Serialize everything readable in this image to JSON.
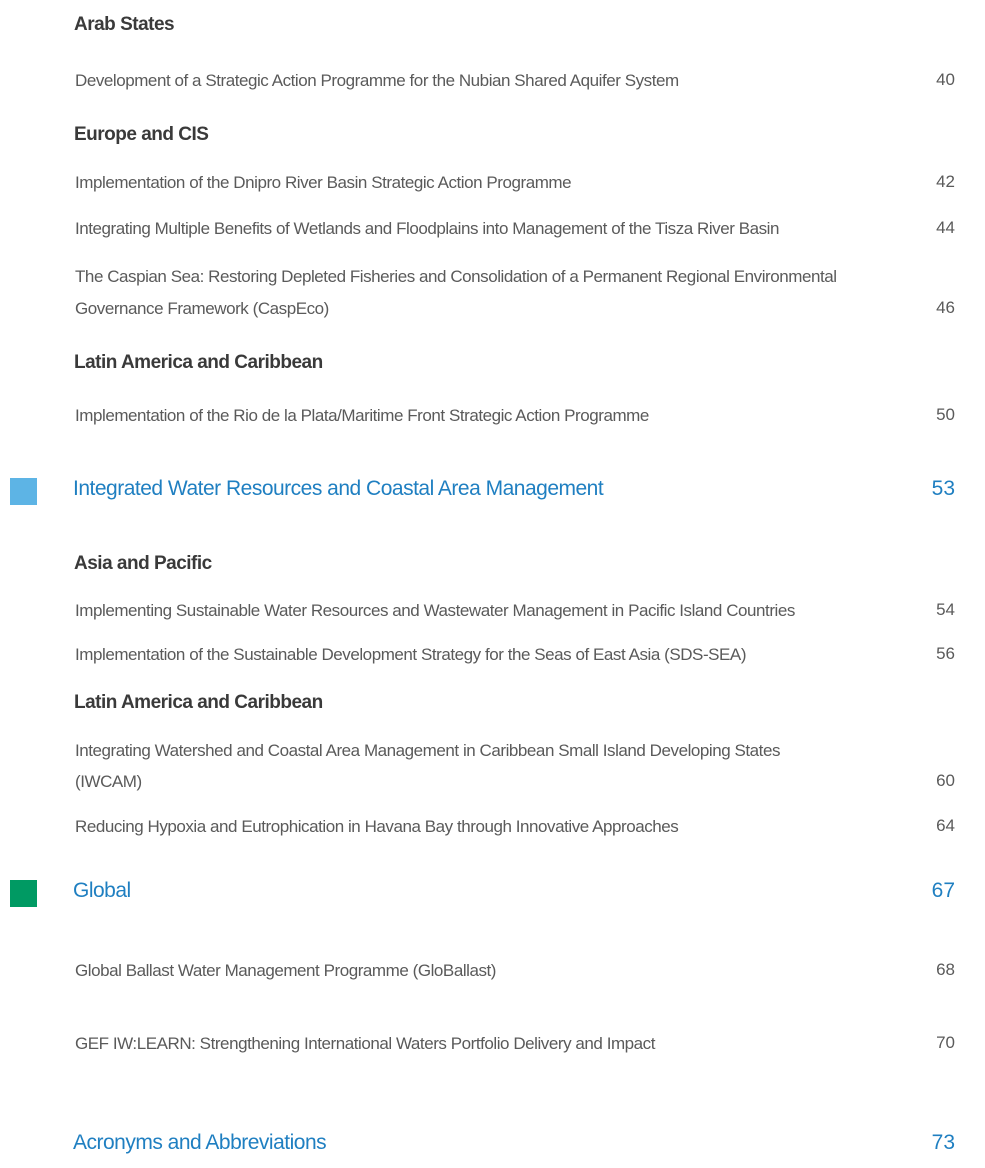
{
  "toc": {
    "arab_states": {
      "heading": "Arab States",
      "entries": [
        {
          "title": "Development of a Strategic Action Programme for the Nubian Shared Aquifer System",
          "page": "40"
        }
      ]
    },
    "europe_cis": {
      "heading": "Europe and CIS",
      "entries": [
        {
          "title": "Implementation of the Dnipro River Basin Strategic Action Programme",
          "page": "42"
        },
        {
          "title": "Integrating Multiple Benefits of Wetlands and Floodplains into Management of the Tisza River Basin",
          "page": "44"
        },
        {
          "title_line1": "The Caspian Sea: Restoring Depleted Fisheries and Consolidation of a Permanent Regional Environmental",
          "title_line2": "Governance Framework (CaspEco)",
          "page": "46"
        }
      ]
    },
    "latin_america_1": {
      "heading": "Latin America and Caribbean",
      "entries": [
        {
          "title": "Implementation of the Rio de la Plata/Maritime Front Strategic Action Programme",
          "page": "50"
        }
      ]
    },
    "section_iwrm": {
      "title": "Integrated Water Resources and Coastal Area Management",
      "page": "53",
      "color": "#5db4e5"
    },
    "asia_pacific": {
      "heading": "Asia and Pacific",
      "entries": [
        {
          "title": "Implementing Sustainable Water Resources and Wastewater Management in Pacific Island Countries",
          "page": "54"
        },
        {
          "title": "Implementation of the Sustainable Development Strategy for the Seas of East Asia (SDS-SEA)",
          "page": "56"
        }
      ]
    },
    "latin_america_2": {
      "heading": "Latin America and Caribbean",
      "entries": [
        {
          "title_line1": "Integrating Watershed and Coastal Area Management in Caribbean Small Island Developing States",
          "title_line2": "(IWCAM)",
          "page": "60"
        },
        {
          "title": "Reducing Hypoxia and Eutrophication in Havana Bay through Innovative Approaches",
          "page": "64"
        }
      ]
    },
    "section_global": {
      "title": "Global",
      "page": "67",
      "color": "#009a63"
    },
    "global": {
      "entries": [
        {
          "title": "Global Ballast Water Management  Programme (GloBallast)",
          "page": "68"
        },
        {
          "title": "GEF IW:LEARN: Strengthening International Waters Portfolio Delivery and Impact",
          "page": "70"
        }
      ]
    },
    "acronyms": {
      "title": "Acronyms and Abbreviations",
      "page": "73"
    }
  },
  "colors": {
    "section_text": "#1f7fc1",
    "heading_text": "#3a3a3a",
    "entry_text": "#5a5a5a"
  }
}
